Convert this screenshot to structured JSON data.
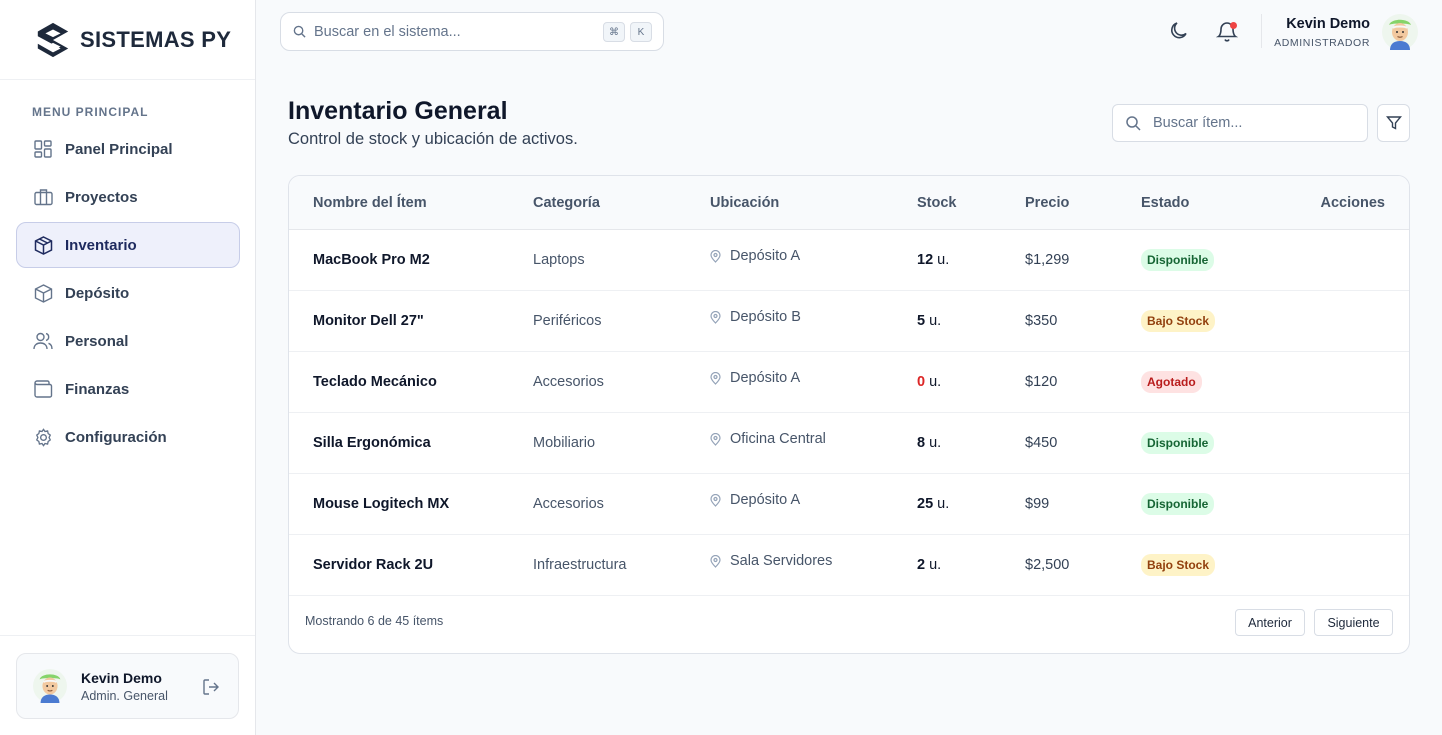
{
  "brand": {
    "name": "SISTEMAS PY"
  },
  "sidebar": {
    "section_title": "MENU PRINCIPAL",
    "items": [
      {
        "label": "Panel Principal",
        "icon": "dashboard-icon"
      },
      {
        "label": "Proyectos",
        "icon": "briefcase-icon"
      },
      {
        "label": "Inventario",
        "icon": "box-icon",
        "active": true
      },
      {
        "label": "Depósito",
        "icon": "package-icon"
      },
      {
        "label": "Personal",
        "icon": "users-icon"
      },
      {
        "label": "Finanzas",
        "icon": "wallet-icon"
      },
      {
        "label": "Configuración",
        "icon": "settings-icon"
      }
    ],
    "user": {
      "name": "Kevin Demo",
      "role": "Admin. General"
    }
  },
  "topbar": {
    "search_placeholder": "Buscar en el sistema...",
    "shortcut_keys": [
      "⌘",
      "K"
    ],
    "user": {
      "name": "Kevin Demo",
      "role": "ADMINISTRADOR"
    }
  },
  "page": {
    "title": "Inventario General",
    "subtitle": "Control de stock y ubicación de activos.",
    "item_search_placeholder": "Buscar ítem..."
  },
  "table": {
    "columns": [
      "Nombre del Ítem",
      "Categoría",
      "Ubicación",
      "Stock",
      "Precio",
      "Estado",
      "Acciones"
    ],
    "rows": [
      {
        "name": "MacBook Pro M2",
        "category": "Laptops",
        "location": "Depósito A",
        "stock": "12",
        "unit": "u.",
        "price": "$1,299",
        "status": "Disponible"
      },
      {
        "name": "Monitor Dell 27\"",
        "category": "Periféricos",
        "location": "Depósito B",
        "stock": "5",
        "unit": "u.",
        "price": "$350",
        "status": "Bajo Stock"
      },
      {
        "name": "Teclado Mecánico",
        "category": "Accesorios",
        "location": "Depósito A",
        "stock": "0",
        "unit": "u.",
        "price": "$120",
        "status": "Agotado"
      },
      {
        "name": "Silla Ergonómica",
        "category": "Mobiliario",
        "location": "Oficina Central",
        "stock": "8",
        "unit": "u.",
        "price": "$450",
        "status": "Disponible"
      },
      {
        "name": "Mouse Logitech MX",
        "category": "Accesorios",
        "location": "Depósito A",
        "stock": "25",
        "unit": "u.",
        "price": "$99",
        "status": "Disponible"
      },
      {
        "name": "Servidor Rack 2U",
        "category": "Infraestructura",
        "location": "Sala Servidores",
        "stock": "2",
        "unit": "u.",
        "price": "$2,500",
        "status": "Bajo Stock"
      }
    ],
    "footer": {
      "showing": "Mostrando 6 de 45 ítems",
      "prev_label": "Anterior",
      "next_label": "Siguiente"
    }
  },
  "colors": {
    "accent": "#1e2a5e",
    "status_available": "#dcfce7",
    "status_low": "#fef3c7",
    "status_out": "#fee2e2"
  }
}
